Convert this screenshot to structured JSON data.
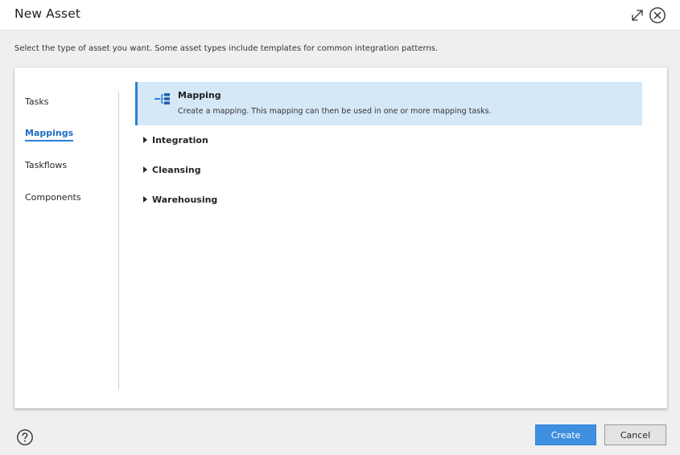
{
  "dialog": {
    "title": "New Asset",
    "instruction": "Select the type of asset you want. Some asset types include templates for common integration patterns."
  },
  "nav": {
    "items": [
      {
        "label": "Tasks",
        "active": false
      },
      {
        "label": "Mappings",
        "active": true
      },
      {
        "label": "Taskflows",
        "active": false
      },
      {
        "label": "Components",
        "active": false
      }
    ]
  },
  "selected_asset": {
    "icon": "mapping-icon",
    "title": "Mapping",
    "description": "Create a mapping. This mapping can then be used in one or more mapping tasks."
  },
  "categories": [
    {
      "label": "Integration",
      "expanded": false
    },
    {
      "label": "Cleansing",
      "expanded": false
    },
    {
      "label": "Warehousing",
      "expanded": false
    }
  ],
  "footer": {
    "create_label": "Create",
    "cancel_label": "Cancel"
  },
  "colors": {
    "accent": "#2b80d8",
    "selection_bg": "#d5e8f8",
    "primary_button": "#3f8fe0"
  }
}
